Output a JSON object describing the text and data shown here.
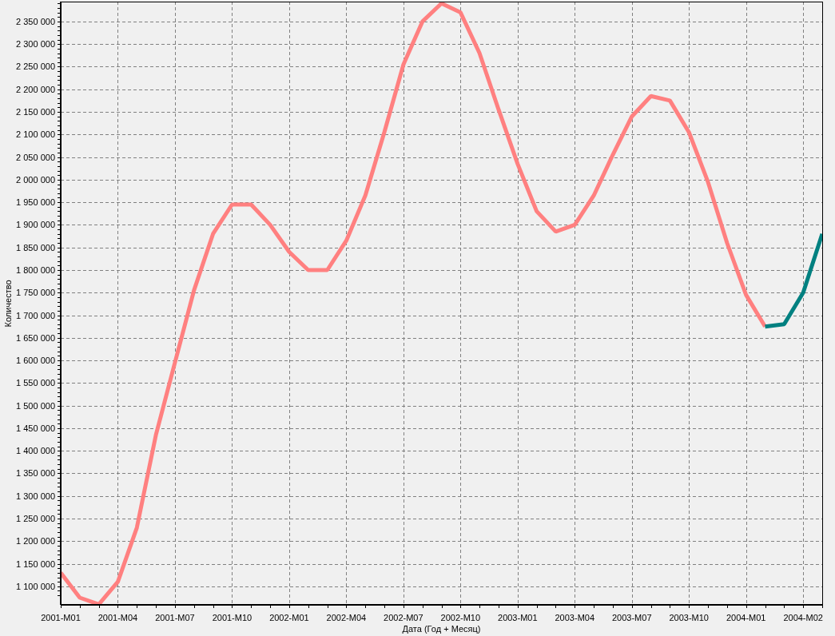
{
  "chart_data": {
    "type": "line",
    "xlabel": "Дата (Год + Месяц)",
    "ylabel": "Количество",
    "categories": [
      "2001-M01",
      null,
      null,
      "2001-M04",
      null,
      null,
      "2001-M07",
      null,
      null,
      "2001-M10",
      null,
      null,
      "2002-M01",
      null,
      null,
      "2002-M04",
      null,
      null,
      "2002-M07",
      null,
      null,
      "2002-M10",
      null,
      null,
      "2003-M01",
      null,
      null,
      "2003-M04",
      null,
      null,
      "2003-M07",
      null,
      null,
      "2003-M10",
      null,
      null,
      "2004-M01",
      null,
      null,
      "2004-M02",
      null
    ],
    "series": [
      {
        "color": "#ff8080",
        "values": [
          1130000,
          1075000,
          1060000,
          1110000,
          1230000,
          1435000,
          1595000,
          1755000,
          1880000,
          1945000,
          1945000,
          1900000,
          1840000,
          1800000,
          1800000,
          1865000,
          1965000,
          2105000,
          2255000,
          2350000,
          2390000,
          2370000,
          2280000,
          2155000,
          2035000,
          1930000,
          1885000,
          1900000,
          1965000,
          2055000,
          2140000,
          2185000,
          2175000,
          2105000,
          1995000,
          1860000,
          1745000,
          1675000,
          null,
          null,
          null
        ]
      },
      {
        "color": "#008080",
        "values": [
          null,
          null,
          null,
          null,
          null,
          null,
          null,
          null,
          null,
          null,
          null,
          null,
          null,
          null,
          null,
          null,
          null,
          null,
          null,
          null,
          null,
          null,
          null,
          null,
          null,
          null,
          null,
          null,
          null,
          null,
          null,
          null,
          null,
          null,
          null,
          null,
          null,
          1675000,
          1680000,
          1750000,
          1880000
        ]
      }
    ],
    "ylim": [
      1059000,
      2394100
    ],
    "grid": true,
    "yticks": [
      {
        "value": 1100000,
        "label": "1 100 000"
      },
      {
        "value": 1150000,
        "label": "1 150 000"
      },
      {
        "value": 1200000,
        "label": "1 200 000"
      },
      {
        "value": 1250000,
        "label": "1 250 000"
      },
      {
        "value": 1300000,
        "label": "1 300 000"
      },
      {
        "value": 1350000,
        "label": "1 350 000"
      },
      {
        "value": 1400000,
        "label": "1 400 000"
      },
      {
        "value": 1450000,
        "label": "1 450 000"
      },
      {
        "value": 1500000,
        "label": "1 500 000"
      },
      {
        "value": 1550000,
        "label": "1 550 000"
      },
      {
        "value": 1600000,
        "label": "1 600 000"
      },
      {
        "value": 1650000,
        "label": "1 650 000"
      },
      {
        "value": 1700000,
        "label": "1 700 000"
      },
      {
        "value": 1750000,
        "label": "1 750 000"
      },
      {
        "value": 1800000,
        "label": "1 800 000"
      },
      {
        "value": 1850000,
        "label": "1 850 000"
      },
      {
        "value": 1900000,
        "label": "1 900 000"
      },
      {
        "value": 1950000,
        "label": "1 950 000"
      },
      {
        "value": 2000000,
        "label": "2 000 000"
      },
      {
        "value": 2050000,
        "label": "2 050 000"
      },
      {
        "value": 2100000,
        "label": "2 100 000"
      },
      {
        "value": 2150000,
        "label": "2 150 000"
      },
      {
        "value": 2200000,
        "label": "2 200 000"
      },
      {
        "value": 2250000,
        "label": "2 250 000"
      },
      {
        "value": 2300000,
        "label": "2 300 000"
      },
      {
        "value": 2350000,
        "label": "2 350 000"
      }
    ]
  }
}
